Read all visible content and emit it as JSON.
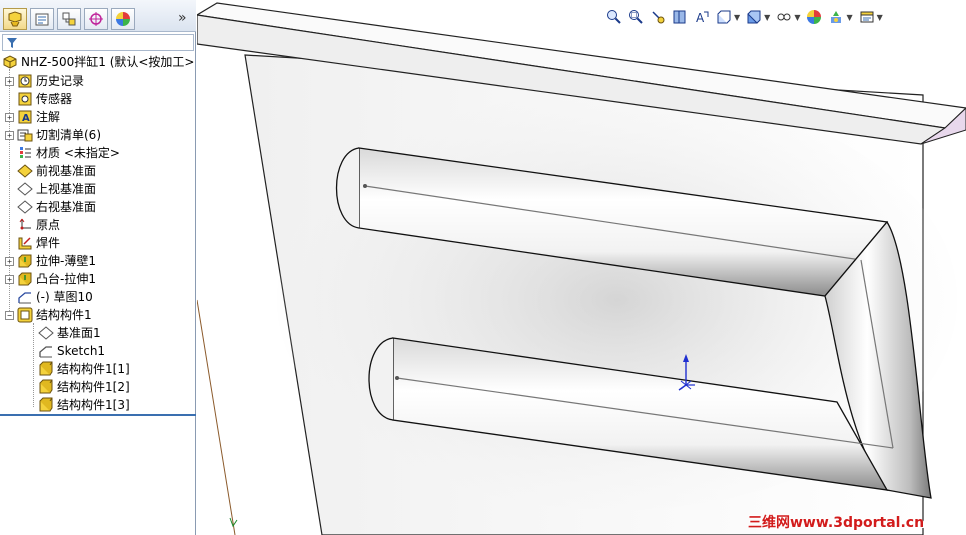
{
  "panel_tabs": [
    {
      "name": "feature-manager",
      "icon": "feature-tree-icon",
      "active": true
    },
    {
      "name": "property-manager",
      "icon": "property-icon",
      "active": false
    },
    {
      "name": "configuration-manager",
      "icon": "configuration-icon",
      "active": false
    },
    {
      "name": "dimxpert-manager",
      "icon": "dimxpert-icon",
      "active": false
    },
    {
      "name": "display-manager",
      "icon": "display-pie-icon",
      "active": false
    }
  ],
  "expand_arrow": "»",
  "tree": {
    "root": "NHZ-500拌缸1  (默认<按加工>",
    "items": [
      {
        "label": "历史记录",
        "icon": "history-icon",
        "expandable": true
      },
      {
        "label": "传感器",
        "icon": "sensor-icon",
        "expandable": false
      },
      {
        "label": "注解",
        "icon": "annotation-icon",
        "expandable": true
      },
      {
        "label": "切割清单(6)",
        "icon": "cut-list-icon",
        "expandable": true
      },
      {
        "label": "材质 <未指定>",
        "icon": "material-icon",
        "expandable": false
      },
      {
        "label": "前视基准面",
        "icon": "plane-icon",
        "expandable": false
      },
      {
        "label": "上视基准面",
        "icon": "plane-icon",
        "expandable": false
      },
      {
        "label": "右视基准面",
        "icon": "plane-icon",
        "expandable": false
      },
      {
        "label": "原点",
        "icon": "origin-icon",
        "expandable": false
      },
      {
        "label": "焊件",
        "icon": "weldment-icon",
        "expandable": false
      },
      {
        "label": "拉伸-薄壁1",
        "icon": "extrude-icon",
        "expandable": true
      },
      {
        "label": "凸台-拉伸1",
        "icon": "extrude-icon",
        "expandable": true
      },
      {
        "label": "(-) 草图10",
        "icon": "sketch-icon",
        "expandable": false
      },
      {
        "label": "结构构件1",
        "icon": "structural-member-icon",
        "expandable": true,
        "expanded": true
      }
    ],
    "children": [
      {
        "label": "基准面1",
        "icon": "plane-icon"
      },
      {
        "label": "Sketch1",
        "icon": "sketch-icon"
      },
      {
        "label": "结构构件1[1]",
        "icon": "body-icon"
      },
      {
        "label": "结构构件1[2]",
        "icon": "body-icon"
      },
      {
        "label": "结构构件1[3]",
        "icon": "body-icon"
      }
    ]
  },
  "toolbar": [
    {
      "icon": "zoom-to-fit-icon",
      "dropdown": false
    },
    {
      "icon": "zoom-to-area-icon",
      "dropdown": false
    },
    {
      "icon": "previous-view-icon",
      "dropdown": false
    },
    {
      "icon": "section-view-icon",
      "dropdown": false
    },
    {
      "icon": "dynamic-annotation-icon",
      "dropdown": false
    },
    {
      "icon": "view-orientation-icon",
      "dropdown": true
    },
    {
      "icon": "display-style-icon",
      "dropdown": true
    },
    {
      "icon": "hide-show-icon",
      "dropdown": true
    },
    {
      "icon": "edit-appearance-icon",
      "dropdown": false
    },
    {
      "icon": "apply-scene-icon",
      "dropdown": true
    },
    {
      "icon": "view-settings-icon",
      "dropdown": true
    }
  ],
  "watermark": "三维网www.3dportal.cn",
  "colors": {
    "panel_border": "#8a9bb2",
    "selection_blue": "#3a6fb0",
    "icon_yellow": "#f4d23c",
    "watermark_red": "#d21b1b"
  }
}
